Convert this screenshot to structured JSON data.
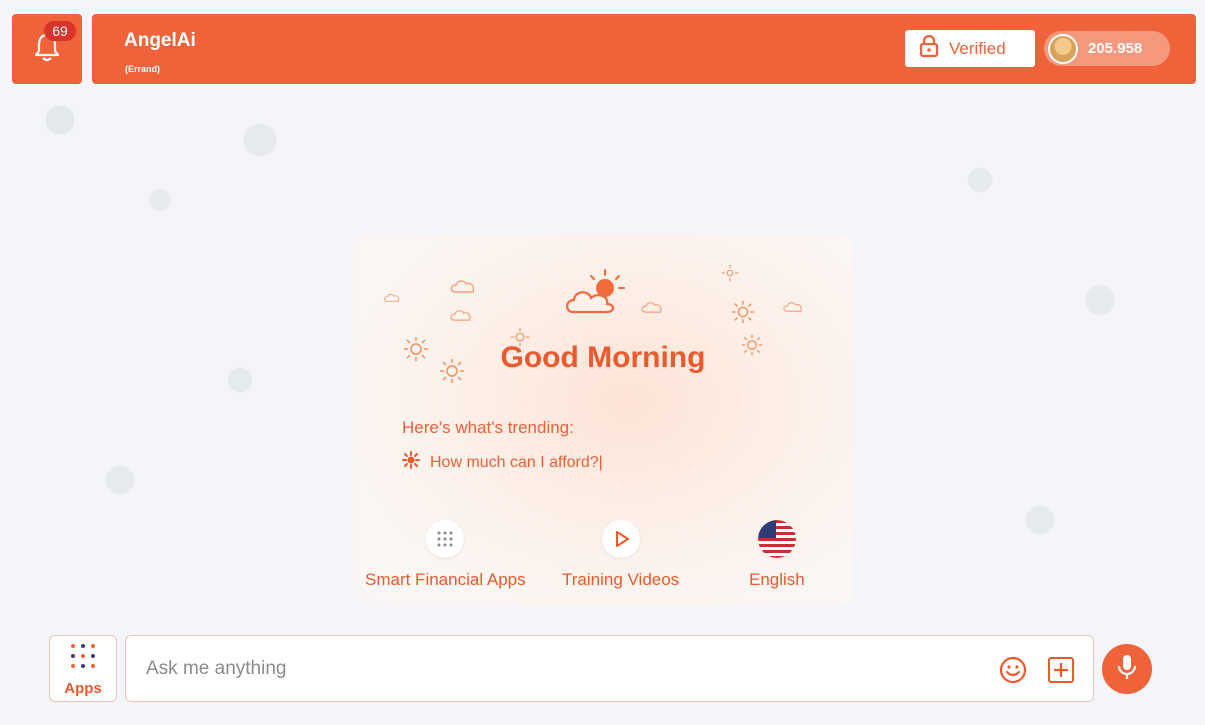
{
  "notifications": {
    "count": "69",
    "icon": "bell-icon"
  },
  "header": {
    "title": "AngelAi",
    "subtitle": "(Errand)",
    "verified_label": "Verified",
    "coins": "205.958"
  },
  "card": {
    "greeting": "Good Morning",
    "trending_label": "Here's what's trending:",
    "trending_items": [
      {
        "text": "How much can I afford?|"
      }
    ],
    "shortcuts": [
      {
        "label": "Smart Financial Apps",
        "icon": "grid-dots-icon"
      },
      {
        "label": "Training Videos",
        "icon": "play-icon"
      },
      {
        "label": "English",
        "icon": "us-flag-icon"
      }
    ]
  },
  "composer": {
    "apps_label": "Apps",
    "placeholder": "Ask me anything"
  },
  "colors": {
    "accent": "#f0633a",
    "badge": "#d8342a",
    "text_accent": "#ea5a2d"
  }
}
